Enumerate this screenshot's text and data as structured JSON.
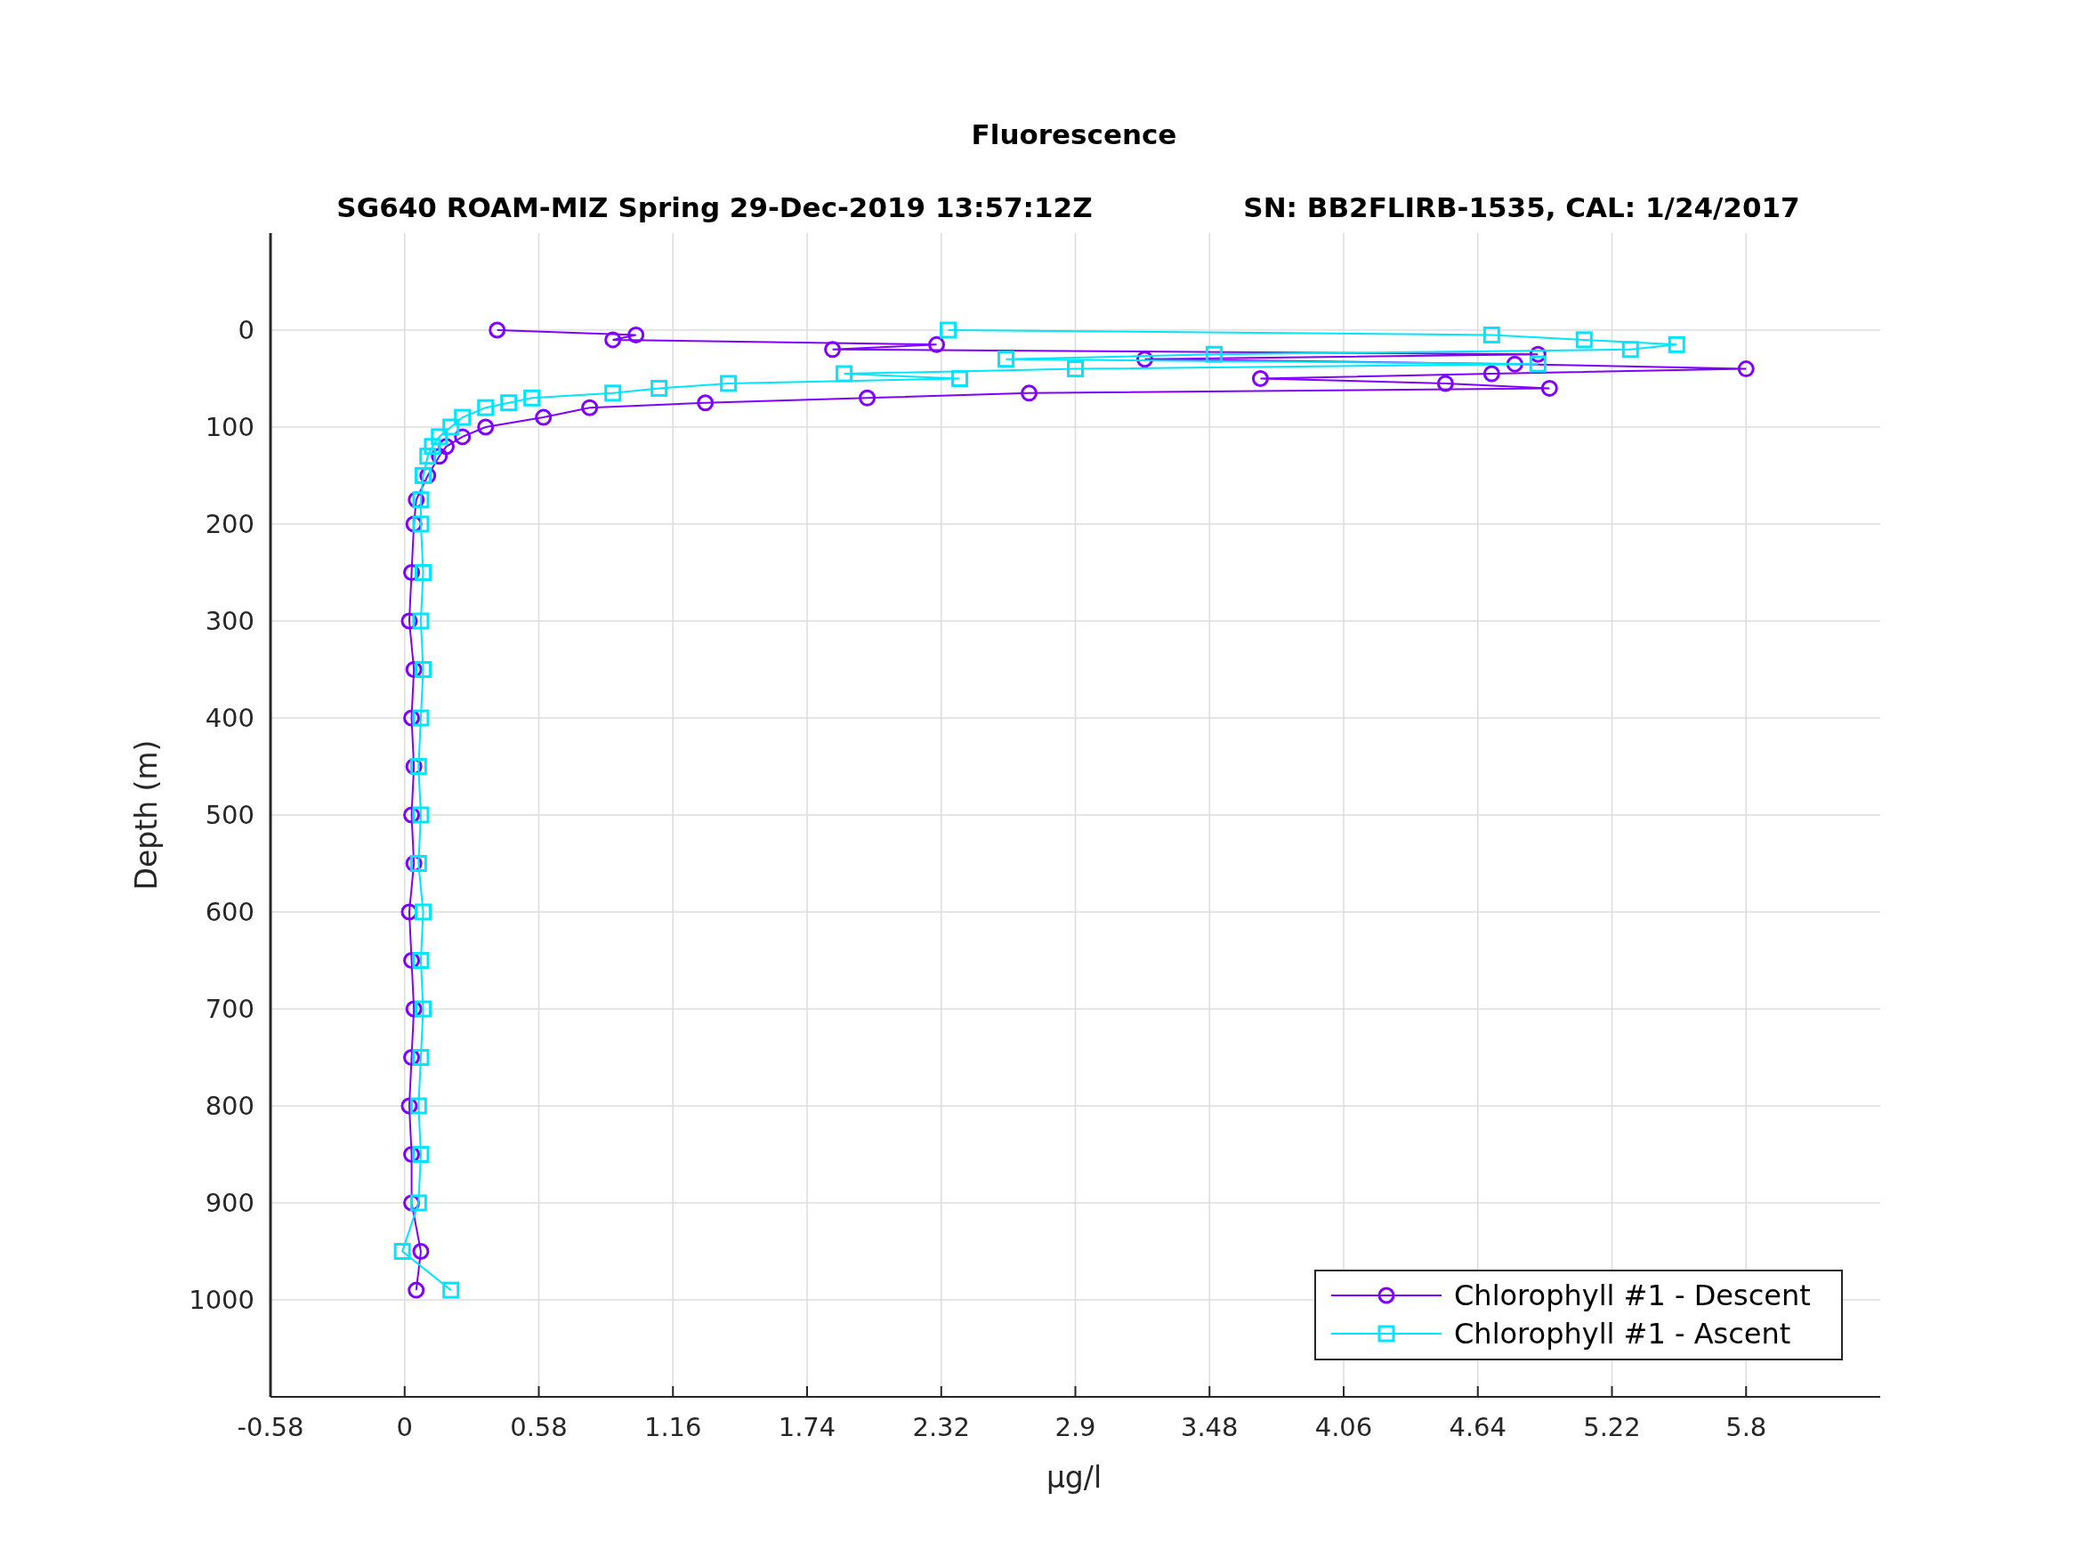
{
  "figure": {
    "subtitles": [
      "SG640 ROAM-MIZ Spring 29-Dec-2019 13:57:12Z",
      "SN: BB2FLIRB-1535, CAL: 1/24/2017"
    ],
    "chart_data": {
      "type": "line",
      "orientation": "horizontal",
      "title": "Fluorescence",
      "xlabel": "μg/l",
      "ylabel": "Depth (m)",
      "x": [
        0,
        5,
        10,
        15,
        20,
        25,
        30,
        35,
        40,
        45,
        50,
        55,
        60,
        65,
        70,
        75,
        80,
        90,
        100,
        110,
        120,
        130,
        150,
        175,
        200,
        250,
        300,
        350,
        400,
        450,
        500,
        550,
        600,
        650,
        700,
        750,
        800,
        850,
        900,
        950,
        990
      ],
      "series": [
        {
          "name": "Chlorophyll #1 - Descent",
          "color": "#8000ff",
          "marker": "circle",
          "values": [
            0.4,
            1.0,
            0.9,
            2.3,
            1.85,
            4.9,
            3.2,
            4.8,
            5.8,
            4.7,
            3.7,
            4.5,
            4.95,
            2.7,
            2.0,
            1.3,
            0.8,
            0.6,
            0.35,
            0.25,
            0.18,
            0.15,
            0.1,
            0.05,
            0.04,
            0.03,
            0.02,
            0.04,
            0.03,
            0.04,
            0.03,
            0.04,
            0.02,
            0.03,
            0.04,
            0.03,
            0.02,
            0.03,
            0.03,
            0.07,
            0.05
          ]
        },
        {
          "name": "Chlorophyll #1 - Ascent",
          "color": "#00e5ff",
          "marker": "square",
          "values": [
            2.35,
            4.7,
            5.1,
            5.5,
            5.3,
            3.5,
            2.6,
            4.9,
            2.9,
            1.9,
            2.4,
            1.4,
            1.1,
            0.9,
            0.55,
            0.45,
            0.35,
            0.25,
            0.2,
            0.15,
            0.12,
            0.1,
            0.08,
            0.07,
            0.07,
            0.08,
            0.07,
            0.08,
            0.07,
            0.06,
            0.07,
            0.06,
            0.08,
            0.07,
            0.08,
            0.07,
            0.06,
            0.07,
            0.06,
            -0.01,
            0.2
          ]
        }
      ],
      "grid": true,
      "legend": "lower right",
      "xlim": [
        -0.58,
        6.38
      ],
      "ylim": [
        1100,
        -100
      ],
      "xticks": [
        -0.58,
        0,
        0.58,
        1.16,
        1.74,
        2.32,
        2.9,
        3.48,
        4.06,
        4.64,
        5.22,
        5.8
      ],
      "yticks": [
        0,
        100,
        200,
        300,
        400,
        500,
        600,
        700,
        800,
        900,
        1000
      ]
    }
  }
}
